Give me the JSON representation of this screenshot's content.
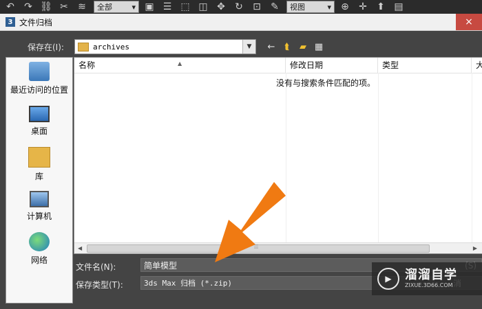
{
  "app_toolbar": {
    "selection_filter": "全部",
    "view_dropdown": "视图"
  },
  "dialog": {
    "title": "文件归档",
    "close_glyph": "×",
    "save_in_label": "保存在(I):",
    "save_in_value": "archives",
    "places": [
      {
        "label": "最近访问的位置",
        "icon": "recent-locations-icon"
      },
      {
        "label": "桌面",
        "icon": "desktop-icon"
      },
      {
        "label": "库",
        "icon": "library-icon"
      },
      {
        "label": "计算机",
        "icon": "computer-icon"
      },
      {
        "label": "网络",
        "icon": "network-icon"
      }
    ],
    "columns": [
      "名称",
      "修改日期",
      "类型",
      "大"
    ],
    "empty_message": "没有与搜索条件匹配的项。",
    "file_name_label": "文件名(N):",
    "file_name_value": "简单模型",
    "file_type_label": "保存类型(T):",
    "file_type_value": "3ds Max 归档 (*.zip)",
    "save_button": "(S)",
    "cancel_button": "消"
  },
  "watermark": {
    "title": "溜溜自学",
    "url": "ZIXUE.3D66.COM"
  },
  "colors": {
    "accent_arrow": "#f07a12",
    "dialog_bg": "#444444",
    "close_button": "#c74a41"
  }
}
